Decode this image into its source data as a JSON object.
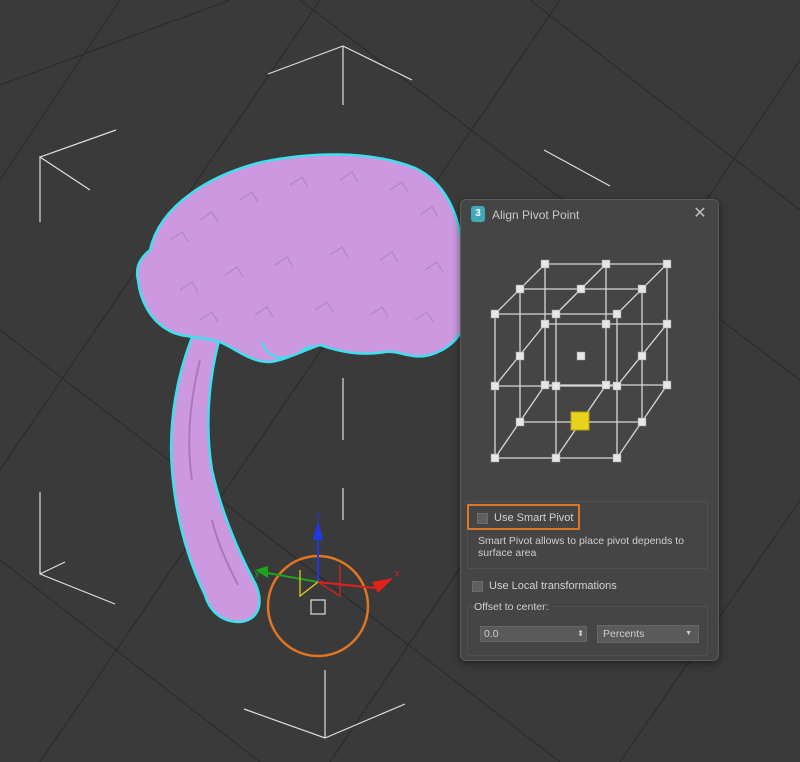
{
  "viewport": {
    "background": "#3a3a3a",
    "object_color": "#cc99e0",
    "selection_outline_color": "#3de0ec",
    "gizmo": {
      "x_label": "x",
      "y_label": "y",
      "z_label": "z",
      "x_color": "#e0221a",
      "y_color": "#1fa21f",
      "z_color": "#1f3ae0",
      "ring_color": "#e07522"
    }
  },
  "dialog": {
    "app_icon_label": "3",
    "title": "Align Pivot Point",
    "close_icon": "close-icon",
    "pivot_grid": {
      "selected_point": "bottom-front-center",
      "selected_color": "#e8d21c"
    },
    "smart_pivot": {
      "label": "Use Smart Pivot",
      "checked": false,
      "description": "Smart Pivot allows to place pivot depends to surface area"
    },
    "local_transform": {
      "label": "Use Local transformations",
      "checked": false
    },
    "offset": {
      "label": "Offset to center:",
      "value": "0.0",
      "unit_selected": "Percents"
    }
  }
}
